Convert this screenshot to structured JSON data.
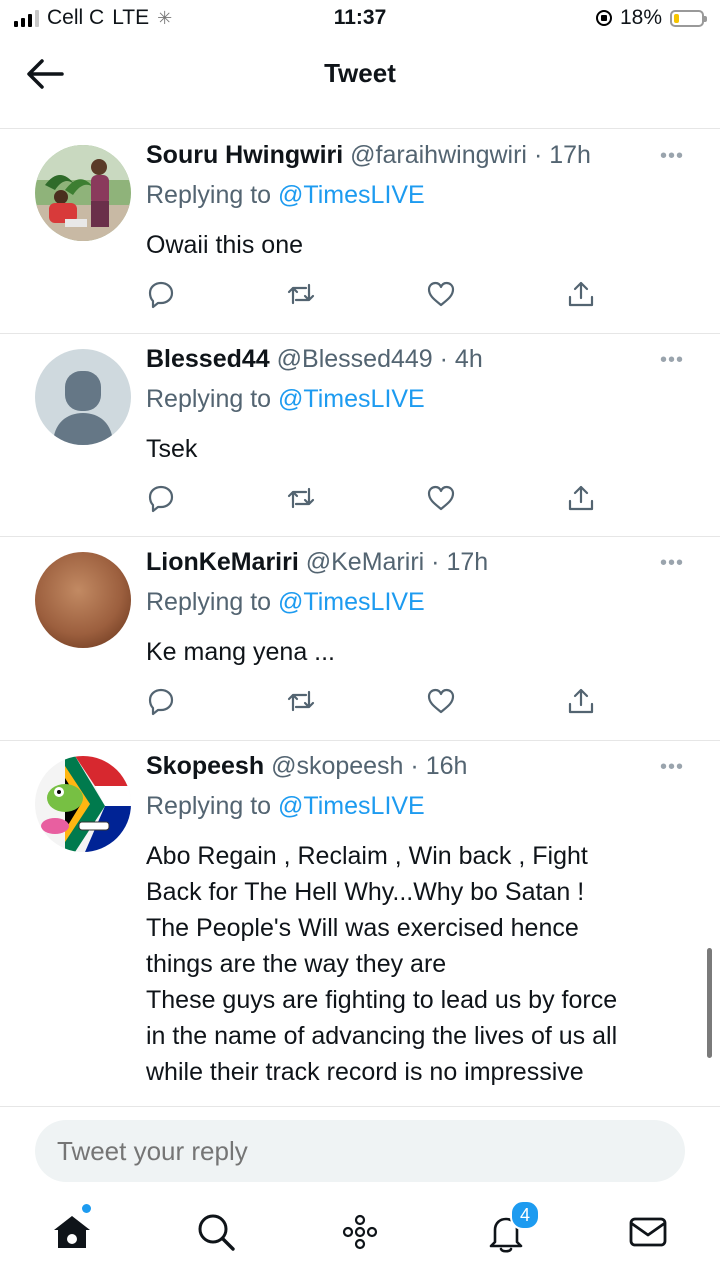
{
  "status_bar": {
    "carrier": "Cell C",
    "network": "LTE",
    "time": "11:37",
    "battery_percent": "18%",
    "battery_level": 0.18,
    "battery_color": "#f5c400"
  },
  "header": {
    "back_icon": "arrow-left-icon",
    "title": "Tweet"
  },
  "tweets": [
    {
      "name": "Souru Hwingwiri",
      "handle": "@faraihwingwiri",
      "sep": "·",
      "time": "17h",
      "reply_prefix": "Replying to",
      "reply_to": "@TimesLIVE",
      "text": "Owaii this one",
      "avatar": "photo-avatar"
    },
    {
      "name": "Blessed44",
      "handle": "@Blessed449",
      "sep": "·",
      "time": "4h",
      "reply_prefix": "Replying to",
      "reply_to": "@TimesLIVE",
      "text": "Tsek",
      "avatar": "default-avatar"
    },
    {
      "name": "LionKeMariri",
      "handle": "@KeMariri",
      "sep": "·",
      "time": "17h",
      "reply_prefix": "Replying to",
      "reply_to": "@TimesLIVE",
      "text": "Ke mang yena ...",
      "avatar": "brown-avatar"
    },
    {
      "name": "Skopeesh",
      "handle": "@skopeesh",
      "sep": "·",
      "time": "16h",
      "reply_prefix": "Replying to",
      "reply_to": "@TimesLIVE",
      "text": "Abo Regain , Reclaim , Win back , Fight\nBack for The Hell Why...Why bo Satan !\nThe People's Will was exercised hence\nthings are the way they are\nThese guys are fighting to lead us by force\nin the name of advancing the lives of us all\nwhile their track record is no impressive",
      "avatar": "cartoon-flag-avatar"
    }
  ],
  "reply_box": {
    "placeholder": "Tweet your reply"
  },
  "tab_bar": {
    "notifications_badge": "4",
    "accent": "#1d9bf0"
  }
}
